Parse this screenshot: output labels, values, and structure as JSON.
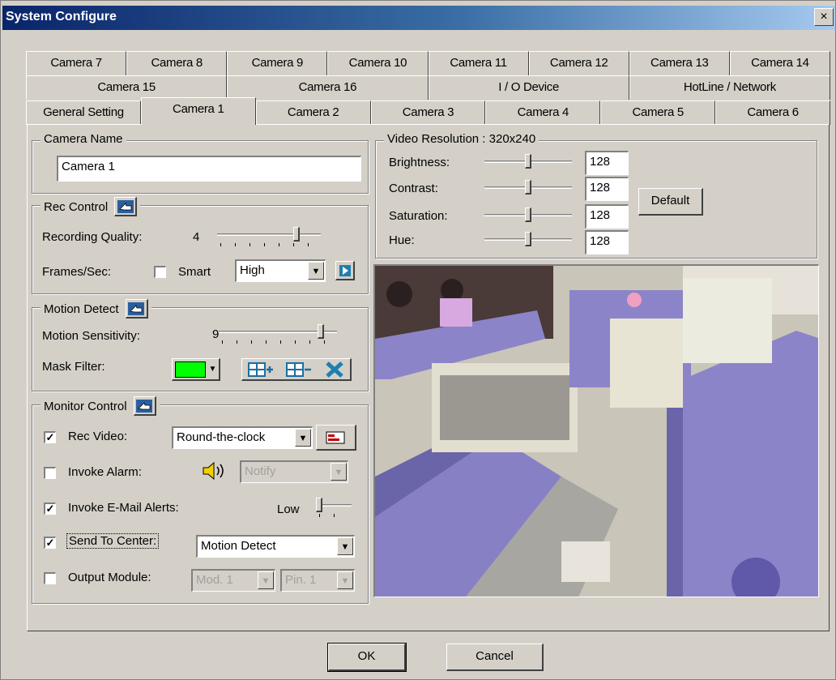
{
  "window": {
    "title": "System Configure",
    "close_label": "×"
  },
  "tabs": {
    "row1": [
      "Camera 7",
      "Camera 8",
      "Camera 9",
      "Camera 10",
      "Camera 11",
      "Camera 12",
      "Camera 13",
      "Camera 14"
    ],
    "row2": [
      "Camera 15",
      "Camera 16",
      "I / O Device",
      "HotLine / Network"
    ],
    "row3": [
      "General Setting",
      "Camera 1",
      "Camera 2",
      "Camera 3",
      "Camera 4",
      "Camera 5",
      "Camera 6"
    ],
    "active": "Camera 1"
  },
  "camera_name": {
    "legend": "Camera Name",
    "value": "Camera 1"
  },
  "rec_control": {
    "legend": "Rec Control",
    "quality_label": "Recording Quality:",
    "quality_value": "4",
    "quality_level": 0.8,
    "fps_label": "Frames/Sec:",
    "smart_label": "Smart",
    "smart_checked": false,
    "fps_value": "High",
    "play_icon": "play-arrow-icon"
  },
  "motion_detect": {
    "legend": "Motion Detect",
    "sensitivity_label": "Motion Sensitivity:",
    "sensitivity_value": "9",
    "sensitivity_level": 0.9,
    "mask_label": "Mask Filter:",
    "mask_color": "#00ff00"
  },
  "monitor_control": {
    "legend": "Monitor Control",
    "rec_video_label": "Rec Video:",
    "rec_video_checked": true,
    "rec_video_value": "Round-the-clock",
    "invoke_alarm_label": "Invoke Alarm:",
    "invoke_alarm_checked": false,
    "alarm_value": "Notify",
    "email_label": "Invoke E-Mail Alerts:",
    "email_checked": true,
    "email_level_label": "Low",
    "email_level": 0.0,
    "send_center_label": "Send To Center:",
    "send_center_checked": true,
    "send_center_value": "Motion Detect",
    "output_label": "Output Module:",
    "output_checked": false,
    "output_mod_value": "Mod. 1",
    "output_pin_value": "Pin. 1"
  },
  "video": {
    "legend": "Video Resolution : 320x240",
    "brightness_label": "Brightness:",
    "brightness_value": "128",
    "contrast_label": "Contrast:",
    "contrast_value": "128",
    "saturation_label": "Saturation:",
    "saturation_value": "128",
    "hue_label": "Hue:",
    "hue_value": "128",
    "default_label": "Default"
  },
  "footer": {
    "ok_label": "OK",
    "cancel_label": "Cancel"
  },
  "colors": {
    "title_start": "#0a246a",
    "title_end": "#a6caf0",
    "face": "#d4d0c8",
    "partition": "#8c84c8"
  }
}
